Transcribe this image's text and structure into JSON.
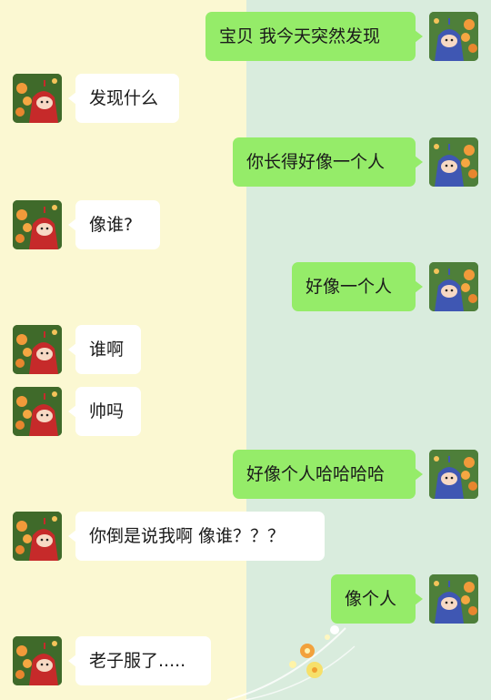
{
  "colors": {
    "left_background": "#fbf8d2",
    "right_background": "#d9ecdd",
    "my_bubble": "#95ec69",
    "peer_bubble": "#ffffff"
  },
  "avatars": {
    "me": "blue-teletubby-avatar-icon",
    "peer": "red-teletubby-avatar-icon"
  },
  "messages": [
    {
      "sender": "me",
      "text": "宝贝 我今天突然发现"
    },
    {
      "sender": "peer",
      "text": "发现什么"
    },
    {
      "sender": "me",
      "text": "你长得好像一个人"
    },
    {
      "sender": "peer",
      "text": "像谁?"
    },
    {
      "sender": "me",
      "text": "好像一个人"
    },
    {
      "sender": "peer",
      "text": "谁啊"
    },
    {
      "sender": "peer",
      "text": "帅吗"
    },
    {
      "sender": "me",
      "text": "好像个人哈哈哈哈"
    },
    {
      "sender": "peer",
      "text": "你倒是说我啊 像谁？？？"
    },
    {
      "sender": "me",
      "text": "像个人"
    },
    {
      "sender": "peer",
      "text": "老子服了....."
    }
  ]
}
